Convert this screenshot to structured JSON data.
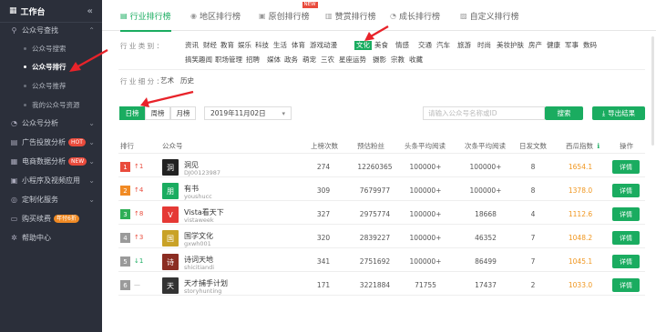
{
  "sidebar": {
    "title": "工作台",
    "collapse_icon": "«",
    "groups": [
      {
        "label": "公众号查找",
        "icon": "search-icon",
        "glyph": "⚲",
        "arrow": "⌃"
      },
      {
        "label": "公众号分析",
        "icon": "chart-icon",
        "glyph": "◔",
        "arrow": "⌄"
      },
      {
        "label": "广告投放分析",
        "icon": "ad-icon",
        "glyph": "▤",
        "arrow": "⌄",
        "badge": "HOT"
      },
      {
        "label": "电商数据分析",
        "icon": "cart-icon",
        "glyph": "▦",
        "arrow": "⌄",
        "badge": "NEW"
      },
      {
        "label": "小程序及视频应用",
        "icon": "app-icon",
        "glyph": "▣",
        "arrow": "⌄"
      },
      {
        "label": "定制化服务",
        "icon": "service-icon",
        "glyph": "◎",
        "arrow": "⌄"
      },
      {
        "label": "购买续费",
        "icon": "purchase-icon",
        "glyph": "▭",
        "badge": "年付6折"
      },
      {
        "label": "帮助中心",
        "icon": "help-icon",
        "glyph": "✲"
      }
    ],
    "sub_items": [
      "公众号搜索",
      "公众号排行",
      "公众号推荐",
      "我的公众号资源"
    ]
  },
  "tabs": [
    {
      "label": "行业排行榜",
      "icon": "list-icon",
      "glyph": "▤"
    },
    {
      "label": "地区排行榜",
      "icon": "location-icon",
      "glyph": "◉"
    },
    {
      "label": "原创排行榜",
      "icon": "original-icon",
      "glyph": "▣",
      "badge": "NEW"
    },
    {
      "label": "赞赏排行榜",
      "icon": "reward-icon",
      "glyph": "▥"
    },
    {
      "label": "成长排行榜",
      "icon": "growth-icon",
      "glyph": "◔"
    },
    {
      "label": "自定义排行榜",
      "icon": "custom-icon",
      "glyph": "▨"
    }
  ],
  "filters": {
    "category_label": "行 业 类 别 ：",
    "categories_row1": [
      "资讯",
      "财经",
      "教育",
      "娱乐",
      "科技",
      "生活",
      "体育",
      "游戏动漫",
      "文化",
      "美食",
      "情感",
      "交通",
      "汽车",
      "旅游",
      "时尚",
      "美妆护肤",
      "房产",
      "健康",
      "军事",
      "数码"
    ],
    "categories_row2": [
      "搞笑趣闻",
      "职场管理",
      "招聘",
      "媒体",
      "政务",
      "萌宠",
      "三农",
      "星座运势",
      "摄影",
      "宗教",
      "收藏"
    ],
    "selected_category": "文化",
    "sub_label": "行 业 细 分 ：",
    "sub_categories": [
      "艺术",
      "历史"
    ]
  },
  "controls": {
    "periods": [
      "日榜",
      "周榜",
      "月榜"
    ],
    "date": "2019年11月02日",
    "date_chevron": "▾",
    "search_placeholder": "请输入公众号名称或ID",
    "search_button": "搜索",
    "export_button": "导出结果",
    "export_glyph": "⤓"
  },
  "table": {
    "headers": [
      "排行",
      "公众号",
      "上榜次数",
      "预估粉丝",
      "头条平均阅读",
      "次条平均阅读",
      "日发文数",
      "西瓜指数",
      "操作"
    ],
    "index_info_glyph": "ℹ",
    "detail_label": "详情",
    "rows": [
      {
        "rank": "1",
        "change": "↑1",
        "dir": "up",
        "name": "洞见",
        "id": "DJ00123987",
        "times": "274",
        "fans": "12260365",
        "head": "100000+",
        "second": "100000+",
        "posts": "8",
        "index": "1654.1",
        "avatar": "洞",
        "avatar_color": "#222222",
        "rank_color": "#e94b3c"
      },
      {
        "rank": "2",
        "change": "↑4",
        "dir": "up",
        "name": "有书",
        "id": "youshucc",
        "times": "309",
        "fans": "7679977",
        "head": "100000+",
        "second": "100000+",
        "posts": "8",
        "index": "1378.0",
        "avatar": "朋",
        "avatar_color": "#1aac60",
        "rank_color": "#f08a24"
      },
      {
        "rank": "3",
        "change": "↑8",
        "dir": "up",
        "name": "Vista看天下",
        "id": "vistaweek",
        "times": "327",
        "fans": "2975774",
        "head": "100000+",
        "second": "18668",
        "posts": "4",
        "index": "1112.6",
        "avatar": "V",
        "avatar_color": "#e53935",
        "rank_color": "#2fae56"
      },
      {
        "rank": "4",
        "change": "↑3",
        "dir": "up",
        "name": "国学文化",
        "id": "gxwh001",
        "times": "320",
        "fans": "2839227",
        "head": "100000+",
        "second": "46352",
        "posts": "7",
        "index": "1048.2",
        "avatar": "国",
        "avatar_color": "#c9a227",
        "rank_color": "#9a9a9a"
      },
      {
        "rank": "5",
        "change": "↓1",
        "dir": "down",
        "name": "诗词天地",
        "id": "shicitiandi",
        "times": "341",
        "fans": "2751692",
        "head": "100000+",
        "second": "86499",
        "posts": "7",
        "index": "1045.1",
        "avatar": "诗",
        "avatar_color": "#8b2d22",
        "rank_color": "#9a9a9a"
      },
      {
        "rank": "6",
        "change": "—",
        "dir": "flat",
        "name": "天才捕手计划",
        "id": "storyhunting",
        "times": "171",
        "fans": "3221884",
        "head": "71755",
        "second": "17437",
        "posts": "2",
        "index": "1033.0",
        "avatar": "天",
        "avatar_color": "#333333",
        "rank_color": "#9a9a9a"
      }
    ]
  }
}
